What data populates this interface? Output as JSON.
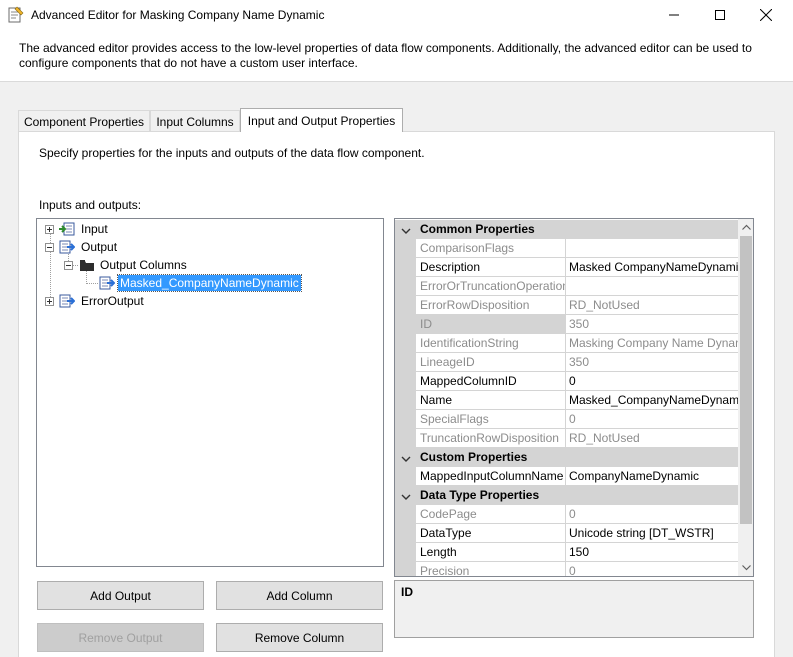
{
  "window": {
    "title": "Advanced Editor for Masking Company Name Dynamic"
  },
  "banner": {
    "description": "The advanced editor provides access to the low-level properties of data flow components. Additionally, the advanced editor can be used to configure components that do not have a custom user interface."
  },
  "tabs": [
    {
      "label": "Component Properties",
      "active": false
    },
    {
      "label": "Input Columns",
      "active": false
    },
    {
      "label": "Input and Output Properties",
      "active": true
    }
  ],
  "panel": {
    "description": "Specify properties for the inputs and outputs of the data flow component.",
    "io_label": "Inputs and outputs:"
  },
  "tree": {
    "input": "Input",
    "output": "Output",
    "output_columns": "Output Columns",
    "selected_column": "Masked_CompanyNameDynamic",
    "error_output": "ErrorOutput"
  },
  "properties": {
    "common": {
      "label": "Common Properties",
      "rows": [
        {
          "name": "ComparisonFlags",
          "value": "",
          "readonly": true
        },
        {
          "name": "Description",
          "value": "Masked CompanyNameDynamic",
          "readonly": false
        },
        {
          "name": "ErrorOrTruncationOperation",
          "value": "",
          "readonly": true
        },
        {
          "name": "ErrorRowDisposition",
          "value": "RD_NotUsed",
          "readonly": true
        },
        {
          "name": "ID",
          "value": "350",
          "readonly": true
        },
        {
          "name": "IdentificationString",
          "value": "Masking Company Name Dynamic",
          "readonly": true
        },
        {
          "name": "LineageID",
          "value": "350",
          "readonly": true
        },
        {
          "name": "MappedColumnID",
          "value": "0",
          "readonly": false
        },
        {
          "name": "Name",
          "value": "Masked_CompanyNameDynamic",
          "readonly": false
        },
        {
          "name": "SpecialFlags",
          "value": "0",
          "readonly": true
        },
        {
          "name": "TruncationRowDisposition",
          "value": "RD_NotUsed",
          "readonly": true
        }
      ]
    },
    "custom": {
      "label": "Custom Properties",
      "rows": [
        {
          "name": "MappedInputColumnName",
          "value": "CompanyNameDynamic",
          "readonly": false
        }
      ]
    },
    "datatype": {
      "label": "Data Type Properties",
      "rows": [
        {
          "name": "CodePage",
          "value": "0",
          "readonly": true
        },
        {
          "name": "DataType",
          "value": "Unicode string [DT_WSTR]",
          "readonly": false
        },
        {
          "name": "Length",
          "value": "150",
          "readonly": false
        },
        {
          "name": "Precision",
          "value": "0",
          "readonly": true
        }
      ]
    }
  },
  "help": {
    "title": "ID"
  },
  "buttons": {
    "add_output": "Add Output",
    "add_column": "Add Column",
    "remove_output": "Remove Output",
    "remove_column": "Remove Column"
  },
  "colors": {
    "selection": "#3399ff",
    "category_bg": "#d4d4d4",
    "readonly_text": "#8c8c8c"
  }
}
